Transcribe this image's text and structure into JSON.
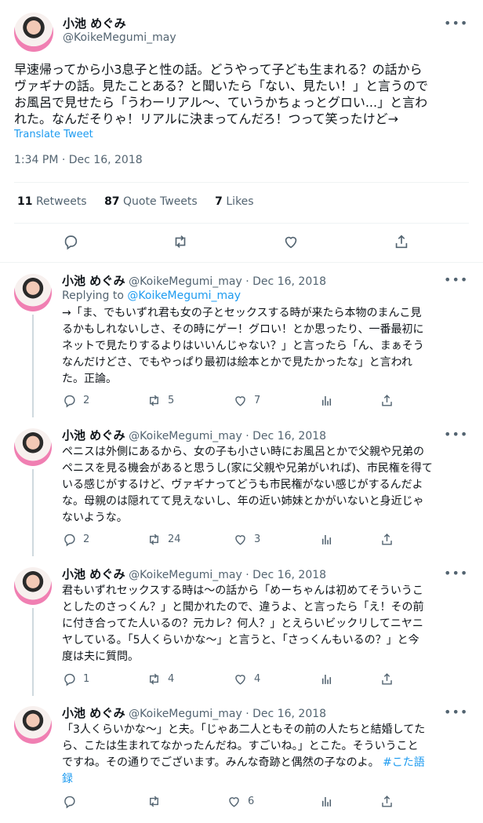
{
  "main": {
    "name": "小池 めぐみ",
    "handle": "@KoikeMegumi_may",
    "text": "早速帰ってから小3息子と性の話。どうやって子ども生まれる？の話から\nヴァギナの話。見たことある？と聞いたら「ない、見たい！」と言うので\nお風呂で見せたら「うわーリアル〜、ていうかちょっとグロい...」と言わ\nれた。なんだそりゃ！リアルに決まってんだろ！つって笑ったけど→",
    "translate": "Translate Tweet",
    "timestamp": "1:34 PM · Dec 16, 2018",
    "retweets": "11",
    "retweets_label": "Retweets",
    "quotes": "87",
    "quotes_label": "Quote Tweets",
    "likes": "7",
    "likes_label": "Likes"
  },
  "replies": [
    {
      "name": "小池 めぐみ",
      "handle": "@KoikeMegumi_may",
      "date": "· Dec 16, 2018",
      "replying_prefix": "Replying to",
      "replying_to": "@KoikeMegumi_may",
      "text": "→「ま、でもいずれ君も女の子とセックスする時が来たら本物のまんこ見\nるかもしれないしさ、その時にゲー！グロい！とか思ったり、一番最初に\nネットで見たりするよりはいいんじゃない？」と言ったら「ん、まぁそう\nなんだけどさ、でもやっぱり最初は絵本とかで見たかったな」と言われ\nた。正論。",
      "replies": "2",
      "retweets": "5",
      "likes": "7"
    },
    {
      "name": "小池 めぐみ",
      "handle": "@KoikeMegumi_may",
      "date": "· Dec 16, 2018",
      "text": "ペニスは外側にあるから、女の子も小さい時にお風呂とかで父親や兄弟の\nペニスを見る機会があると思うし(家に父親や兄弟がいれば)、市民権を得て\nいる感じがするけど、ヴァギナってどうも市民権がない感じがするんだよ\nな。母親のは隠れてて見えないし、年の近い姉妹とかがいないと身近じゃ\nないような。",
      "replies": "2",
      "retweets": "24",
      "likes": "3"
    },
    {
      "name": "小池 めぐみ",
      "handle": "@KoikeMegumi_may",
      "date": "· Dec 16, 2018",
      "text": "君もいずれセックスする時は〜の話から「めーちゃんは初めてそういうこ\nとしたのさっくん？」と聞かれたので、違うよ、と言ったら「え！その前\nに付き合ってた人いるの？元カレ？何人？」とえらいビックリしてニヤニ\nヤしている。「5人くらいかな〜」と言うと、「さっくんもいるの？」と今\n度は夫に質問。",
      "replies": "1",
      "retweets": "4",
      "likes": "4"
    },
    {
      "name": "小池 めぐみ",
      "handle": "@KoikeMegumi_may",
      "date": "· Dec 16, 2018",
      "text": "「3人くらいかな〜」と夫。「じゃあ二人ともその前の人たちと結婚してた\nら、こたは生まれてなかったんだね。すごいね。」とこた。そういうこと\nですね。その通りでございます。みんな奇跡と偶然の子なのよ。",
      "hashtag": "#こた語\n録",
      "replies": "",
      "retweets": "",
      "likes": "6"
    }
  ],
  "icons": [
    "more-icon",
    "reply-icon",
    "retweet-icon",
    "like-icon",
    "share-icon",
    "analytics-icon"
  ],
  "colors": {
    "accent": "#1d9bf0",
    "muted": "#536471",
    "text": "#0f1419",
    "border": "#eff3f4"
  }
}
